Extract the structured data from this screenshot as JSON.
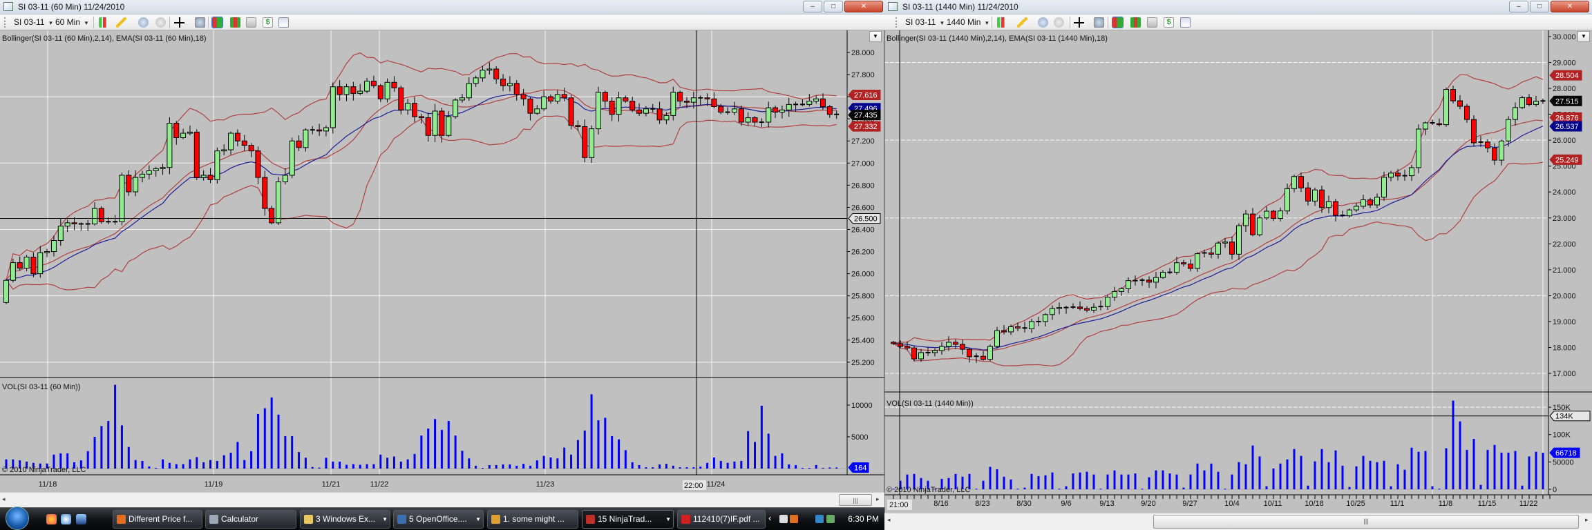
{
  "left_window": {
    "title": "SI 03-11 (60 Min)  11/24/2010",
    "toolbar": {
      "instrument": "SI 03-11",
      "interval": "60 Min"
    },
    "indicator_label": "Bollinger(SI 03-11 (60 Min),2,14), EMA(SI 03-11 (60 Min),18)",
    "volume_label": "VOL(SI 03-11 (60 Min))",
    "copyright": "© 2010 NinjaTrader, LLC",
    "price_ticks": [
      "28.000",
      "27.800",
      "27.600",
      "27.400",
      "27.200",
      "27.000",
      "26.800",
      "26.600",
      "26.400",
      "26.200",
      "26.000",
      "25.800",
      "25.600",
      "25.400",
      "25.200"
    ],
    "volume_ticks": [
      "10000",
      "5000"
    ],
    "date_labels": [
      "11/18",
      "11/19",
      "11/21",
      "11/22",
      "11/23",
      "11/24"
    ],
    "crosshair": {
      "time_label": "22:00",
      "price_label": "26.500",
      "price": 26.5
    },
    "price_tags": [
      {
        "text": "27.616",
        "value": 27.616,
        "color": "#b22222"
      },
      {
        "text": "27.496",
        "value": 27.496,
        "color": "#00008b"
      },
      {
        "text": "27.435",
        "value": 27.435,
        "color": "#000000"
      },
      {
        "text": "27.332",
        "value": 27.332,
        "color": "#b22222"
      }
    ],
    "volume_tag": {
      "text": "164",
      "value": 164,
      "color": "#0000ff"
    },
    "chart_data": {
      "type": "candlestick",
      "title": "SI 03-11 (60 Min)",
      "first_open": 25.74,
      "closes": [
        25.94,
        26.1,
        26.05,
        26.15,
        26.0,
        26.19,
        26.2,
        26.3,
        26.43,
        26.46,
        26.45,
        26.45,
        26.45,
        26.59,
        26.47,
        26.47,
        26.47,
        26.89,
        26.74,
        26.87,
        26.9,
        26.93,
        26.95,
        26.96,
        27.36,
        27.23,
        27.27,
        27.28,
        26.87,
        26.89,
        26.85,
        27.11,
        27.12,
        27.27,
        27.2,
        27.16,
        27.11,
        26.87,
        26.59,
        26.46,
        26.83,
        26.89,
        27.2,
        27.14,
        27.3,
        27.3,
        27.29,
        27.32,
        27.69,
        27.62,
        27.69,
        27.63,
        27.65,
        27.74,
        27.7,
        27.58,
        27.73,
        27.68,
        27.48,
        27.54,
        27.42,
        27.41,
        27.25,
        27.47,
        27.25,
        27.42,
        27.57,
        27.59,
        27.72,
        27.77,
        27.84,
        27.85,
        27.76,
        27.7,
        27.72,
        27.62,
        27.58,
        27.45,
        27.49,
        27.6,
        27.56,
        27.62,
        27.59,
        27.34,
        27.33,
        27.05,
        27.31,
        27.64,
        27.56,
        27.44,
        27.59,
        27.56,
        27.48,
        27.45,
        27.49,
        27.49,
        27.39,
        27.43,
        27.64,
        27.56,
        27.55,
        27.59,
        27.59,
        27.58,
        27.51,
        27.46,
        27.46,
        27.49,
        27.37,
        27.41,
        27.37,
        27.37,
        27.5,
        27.46,
        27.48,
        27.53,
        27.53,
        27.53,
        27.56,
        27.58,
        27.51,
        27.44,
        27.435
      ],
      "volumes": [
        1450,
        1450,
        1300,
        1100,
        900,
        800,
        800,
        2200,
        2400,
        2400,
        1000,
        1300,
        2750,
        5000,
        6700,
        7500,
        13200,
        6800,
        3400,
        1350,
        1200,
        350,
        100,
        1450,
        900,
        700,
        700,
        1450,
        1800,
        1000,
        1350,
        1200,
        2100,
        2500,
        4200,
        1350,
        2750,
        8600,
        9500,
        11200,
        8500,
        5100,
        5100,
        2600,
        1700,
        250,
        150,
        1700,
        1100,
        1100,
        600,
        700,
        600,
        700,
        700,
        2200,
        1700,
        1900,
        1100,
        1450,
        2300,
        5200,
        6300,
        7800,
        6100,
        7500,
        5200,
        2800,
        1600,
        450,
        100,
        550,
        550,
        650,
        650,
        450,
        750,
        450,
        1300,
        2000,
        1750,
        1600,
        3300,
        2200,
        4500,
        6000,
        11700,
        7600,
        8000,
        5100,
        4600,
        2900,
        1000,
        550,
        200,
        200,
        650,
        750,
        450,
        200,
        200,
        200,
        300,
        900,
        1750,
        1200,
        900,
        1100,
        1200,
        5900,
        4200,
        9900,
        5500,
        2000,
        2400,
        650,
        550,
        100,
        100,
        550,
        100,
        160,
        164
      ],
      "indicators": {
        "bollinger": {
          "std_dev": 2,
          "period": 14,
          "color": "#b04040"
        },
        "ema": {
          "period": 18,
          "color": "#1c1c96"
        }
      },
      "ylim": [
        25.1,
        28.1
      ],
      "colors": {
        "up": "#90ee90",
        "down": "#ff0000",
        "volume": "#0000ff",
        "background": "#c0c0c0"
      }
    }
  },
  "right_window": {
    "title": "SI 03-11 (1440 Min)  11/24/2010",
    "toolbar": {
      "instrument": "SI 03-11",
      "interval": "1440 Min"
    },
    "indicator_label": "Bollinger(SI 03-11 (1440 Min),2,14), EMA(SI 03-11 (1440 Min),18)",
    "volume_label": "VOL(SI 03-11 (1440 Min))",
    "copyright": "© 2010 NinjaTrader, LLC",
    "price_ticks": [
      "30.000",
      "29.000",
      "28.000",
      "27.000",
      "26.000",
      "25.000",
      "24.000",
      "23.000",
      "22.000",
      "21.000",
      "20.000",
      "19.000",
      "18.000",
      "17.000"
    ],
    "volume_ticks": [
      "150K",
      "100K",
      "50000",
      "0"
    ],
    "date_labels": [
      "8/16",
      "8/23",
      "8/30",
      "9/6",
      "9/13",
      "9/20",
      "9/27",
      "10/4",
      "10/11",
      "10/18",
      "10/25",
      "11/1",
      "11/8",
      "11/15",
      "11/22"
    ],
    "crosshair": {
      "time_label": "21:00",
      "volume_label": "134K",
      "volume": 134000
    },
    "price_tags": [
      {
        "text": "28.504",
        "value": 28.504,
        "color": "#b22222"
      },
      {
        "text": "27.515",
        "value": 27.515,
        "color": "#000000"
      },
      {
        "text": "26.876",
        "value": 26.876,
        "color": "#b22222"
      },
      {
        "text": "26.537",
        "value": 26.537,
        "color": "#00008b"
      },
      {
        "text": "25.249",
        "value": 25.249,
        "color": "#b22222"
      }
    ],
    "volume_tag": {
      "text": "66718",
      "value": 66718,
      "color": "#0000ff"
    },
    "chart_data": {
      "type": "candlestick",
      "title": "SI 03-11 (1440 Min)",
      "first_open": 18.2,
      "closes": [
        18.15,
        18.04,
        17.98,
        17.56,
        17.8,
        17.8,
        17.88,
        18.04,
        18.2,
        18.12,
        17.93,
        17.64,
        17.66,
        17.54,
        18.04,
        18.65,
        18.6,
        18.8,
        18.75,
        18.72,
        19.0,
        19.0,
        19.27,
        19.5,
        19.54,
        19.53,
        19.56,
        19.5,
        19.44,
        19.55,
        19.58,
        19.94,
        20.16,
        20.27,
        20.58,
        20.58,
        20.6,
        20.52,
        20.7,
        20.9,
        20.9,
        21.27,
        21.22,
        21.05,
        21.62,
        21.65,
        21.6,
        22.03,
        22.07,
        21.6,
        22.7,
        23.15,
        22.35,
        23.0,
        23.26,
        22.98,
        23.27,
        24.13,
        24.6,
        24.16,
        23.65,
        24.08,
        23.4,
        23.63,
        23.1,
        23.08,
        23.31,
        23.45,
        23.7,
        23.5,
        23.8,
        24.57,
        24.73,
        24.62,
        24.63,
        24.94,
        26.43,
        26.67,
        26.64,
        26.6,
        27.96,
        27.52,
        27.31,
        26.8,
        25.9,
        25.93,
        25.7,
        25.23,
        25.97,
        26.8,
        27.26,
        27.64,
        27.38,
        27.5,
        27.515
      ],
      "volumes": [
        1000,
        15500,
        27000,
        28000,
        20600,
        15500,
        1000,
        19000,
        20600,
        28000,
        23000,
        28000,
        1000,
        15500,
        41000,
        36500,
        23000,
        18000,
        1000,
        3000,
        28000,
        24000,
        25600,
        30700,
        1000,
        5500,
        29000,
        30700,
        32000,
        27000,
        1000,
        27000,
        34500,
        27000,
        27000,
        29000,
        1000,
        22000,
        34500,
        34500,
        29000,
        27000,
        3000,
        27000,
        47000,
        34500,
        47000,
        32000,
        1000,
        27000,
        49600,
        45800,
        80000,
        60000,
        5500,
        38000,
        47000,
        54600,
        73500,
        61000,
        6700,
        51000,
        73500,
        49600,
        71000,
        43000,
        4200,
        42000,
        61000,
        52000,
        49600,
        52000,
        5500,
        45800,
        35700,
        76000,
        68500,
        70000,
        5500,
        1000,
        75000,
        162000,
        124000,
        72000,
        92000,
        8000,
        72000,
        81000,
        67000,
        67000,
        70000,
        6700,
        60000,
        68500,
        66718
      ],
      "indicators": {
        "bollinger": {
          "std_dev": 2,
          "period": 14,
          "color": "#b04040"
        },
        "ema": {
          "period": 18,
          "color": "#1c1c96"
        }
      },
      "ylim": [
        16.7,
        30.2
      ],
      "colors": {
        "up": "#90ee90",
        "down": "#ff0000",
        "volume": "#0000ff",
        "background": "#c0c0c0"
      }
    }
  },
  "window_buttons": {
    "minimize": "–",
    "maximize": "□",
    "close": "✕"
  },
  "chart_menu_glyph": "▼",
  "taskbar": {
    "items": [
      {
        "label": "Different Price f...",
        "icon": "firefox-icon",
        "color": "#e66b1a"
      },
      {
        "label": "Calculator",
        "icon": "calculator-icon",
        "color": "#9aa8b8"
      },
      {
        "label": "3 Windows Ex...",
        "icon": "folder-icon",
        "color": "#e8c860"
      },
      {
        "label": "5 OpenOffice....",
        "icon": "openoffice-icon",
        "color": "#3a6fb0"
      },
      {
        "label": "1. some might ...",
        "icon": "pencil-icon",
        "color": "#e0a030"
      },
      {
        "label": "15 NinjaTrad...",
        "icon": "ninjatrader-icon",
        "color": "#c0302a"
      },
      {
        "label": "112410(7)IF.pdf ...",
        "icon": "pdf-icon",
        "color": "#d02020"
      }
    ],
    "clock": "6:30 PM",
    "tray_chevron": "‹"
  }
}
